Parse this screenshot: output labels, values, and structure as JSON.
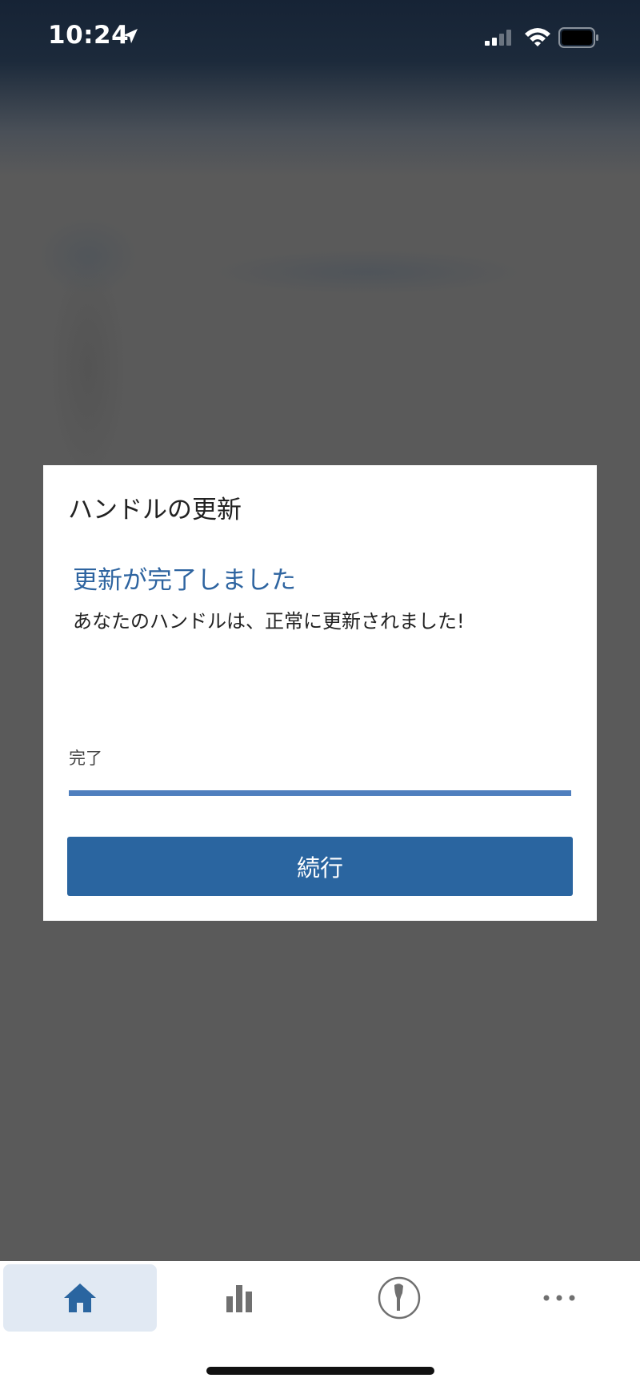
{
  "status_bar": {
    "time": "10:24"
  },
  "dialog": {
    "title": "ハンドルの更新",
    "heading": "更新が完了しました",
    "message": "あなたのハンドルは、正常に更新されました!",
    "progress_label": "完了",
    "progress_percent": 100,
    "continue_label": "続行"
  },
  "tab_bar": {
    "items": [
      {
        "icon": "home-icon",
        "active": true
      },
      {
        "icon": "bar-chart-icon",
        "active": false
      },
      {
        "icon": "toothbrush-icon",
        "active": false
      },
      {
        "icon": "more-icon",
        "active": false
      }
    ]
  },
  "colors": {
    "accent": "#2a65a0",
    "heading": "#2e64a0",
    "progress": "#4f7fbe",
    "overlay": "#5a5a5a",
    "tab_active_bg": "#e1e9f3"
  }
}
